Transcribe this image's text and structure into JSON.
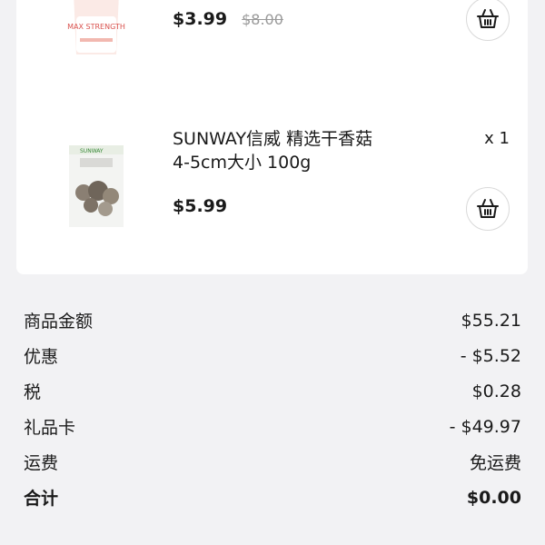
{
  "items": [
    {
      "image_alt": "product-bottle",
      "image_text": "MAX STRENGTH",
      "price": "$3.99",
      "old_price": "$8.00",
      "cart_icon": "basket-icon"
    },
    {
      "image_alt": "product-bag",
      "image_text": "SUNWAY",
      "name_line1": "SUNWAY信威 精选干香菇",
      "name_line2": "4-5cm大小 100g",
      "quantity": "x 1",
      "price": "$5.99",
      "cart_icon": "basket-icon"
    }
  ],
  "summary": [
    {
      "label": "商品金额",
      "value": "$55.21"
    },
    {
      "label": "优惠",
      "value": "- $5.52"
    },
    {
      "label": "税",
      "value": "$0.28"
    },
    {
      "label": "礼品卡",
      "value": "- $49.97"
    },
    {
      "label": "运费",
      "value": "免运费"
    }
  ],
  "total": {
    "label": "合计",
    "value": "$0.00"
  },
  "colors": {
    "background": "#f2f2f4",
    "card": "#ffffff",
    "text": "#1a1a1a",
    "muted": "#9a9a9a"
  }
}
